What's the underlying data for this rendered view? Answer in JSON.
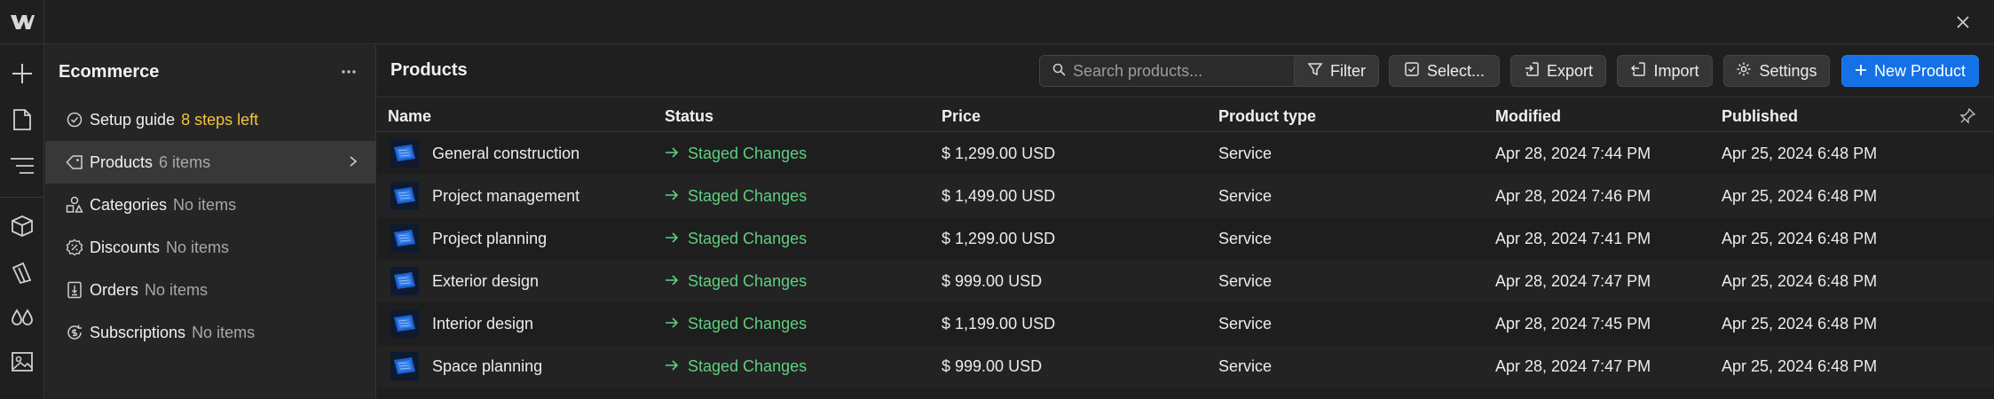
{
  "window": {
    "close_icon": "close-icon",
    "logo_icon": "webflow-logo-icon"
  },
  "rail": {
    "items": [
      {
        "icon": "plus-icon"
      },
      {
        "icon": "page-icon"
      },
      {
        "icon": "navigator-icon"
      },
      {
        "icon": "cube-icon"
      },
      {
        "icon": "cms-icon"
      },
      {
        "icon": "drops-icon"
      },
      {
        "icon": "assets-icon"
      }
    ]
  },
  "sidebar": {
    "title": "Ecommerce",
    "more_icon": "more-horizontal-icon",
    "items": [
      {
        "icon": "check-circle-icon",
        "label": "Setup guide",
        "sub": "8 steps left",
        "sub_color": "#f5c33b"
      },
      {
        "icon": "tag-icon",
        "label": "Products",
        "sub": "6 items",
        "active": true
      },
      {
        "icon": "shapes-icon",
        "label": "Categories",
        "sub": "No items"
      },
      {
        "icon": "discount-icon",
        "label": "Discounts",
        "sub": "No items"
      },
      {
        "icon": "orders-icon",
        "label": "Orders",
        "sub": "No items"
      },
      {
        "icon": "subscription-icon",
        "label": "Subscriptions",
        "sub": "No items"
      }
    ]
  },
  "main": {
    "title": "Products",
    "search": {
      "placeholder": "Search products..."
    },
    "toolbar": {
      "filter": "Filter",
      "select": "Select...",
      "export": "Export",
      "import": "Import",
      "settings": "Settings",
      "new_product": "New Product"
    },
    "columns": [
      "Name",
      "Status",
      "Price",
      "Product type",
      "Modified",
      "Published"
    ],
    "rows": [
      {
        "name": "General construction",
        "status": "Staged Changes",
        "price": "$ 1,299.00 USD",
        "type": "Service",
        "modified": "Apr 28, 2024 7:44 PM",
        "published": "Apr 25, 2024 6:48 PM"
      },
      {
        "name": "Project management",
        "status": "Staged Changes",
        "price": "$ 1,499.00 USD",
        "type": "Service",
        "modified": "Apr 28, 2024 7:46 PM",
        "published": "Apr 25, 2024 6:48 PM"
      },
      {
        "name": "Project planning",
        "status": "Staged Changes",
        "price": "$ 1,299.00 USD",
        "type": "Service",
        "modified": "Apr 28, 2024 7:41 PM",
        "published": "Apr 25, 2024 6:48 PM"
      },
      {
        "name": "Exterior design",
        "status": "Staged Changes",
        "price": "$ 999.00 USD",
        "type": "Service",
        "modified": "Apr 28, 2024 7:47 PM",
        "published": "Apr 25, 2024 6:48 PM"
      },
      {
        "name": "Interior design",
        "status": "Staged Changes",
        "price": "$ 1,199.00 USD",
        "type": "Service",
        "modified": "Apr 28, 2024 7:45 PM",
        "published": "Apr 25, 2024 6:48 PM"
      },
      {
        "name": "Space planning",
        "status": "Staged Changes",
        "price": "$ 999.00 USD",
        "type": "Service",
        "modified": "Apr 28, 2024 7:47 PM",
        "published": "Apr 25, 2024 6:48 PM"
      }
    ],
    "colors": {
      "accent": "#1471e6",
      "status": "#5fcf80",
      "warning": "#f5c33b"
    }
  }
}
